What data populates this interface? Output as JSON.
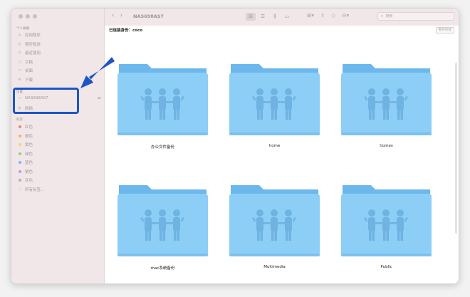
{
  "window": {
    "title": "NAS698AS7"
  },
  "sidebar": {
    "favorites_label": "个人收藏",
    "favorites": [
      {
        "label": "应用程序",
        "icon": "apps-icon"
      },
      {
        "label": "隔空投送",
        "icon": "airdrop-icon"
      },
      {
        "label": "最近使用",
        "icon": "clock-icon"
      },
      {
        "label": "文稿",
        "icon": "doc-icon"
      },
      {
        "label": "桌面",
        "icon": "desktop-icon"
      },
      {
        "label": "下载",
        "icon": "download-icon"
      }
    ],
    "locations_label": "位置",
    "locations": [
      {
        "label": "NAS698AS7",
        "icon": "server-icon"
      },
      {
        "label": "网络",
        "icon": "network-icon"
      }
    ],
    "tags_label": "标签",
    "tags": [
      {
        "label": "红色",
        "color": "#f0827e"
      },
      {
        "label": "橙色",
        "color": "#f3b36a"
      },
      {
        "label": "黄色",
        "color": "#f1d66a"
      },
      {
        "label": "绿色",
        "color": "#8dd27f"
      },
      {
        "label": "蓝色",
        "color": "#7fb4f0"
      },
      {
        "label": "紫色",
        "color": "#c596e6"
      },
      {
        "label": "灰色",
        "color": "#b5b0b2"
      }
    ],
    "all_tags": "所有标签…"
  },
  "toolbar": {
    "back": "‹",
    "forward": "›",
    "search_placeholder": "搜索"
  },
  "pathbar": {
    "connected_as": "已连接身份：coco",
    "disconnect": "断开连接"
  },
  "folders": [
    {
      "name": "办公文件备份"
    },
    {
      "name": "home"
    },
    {
      "name": "homes"
    },
    {
      "name": "mac系统备份"
    },
    {
      "name": "Multimedia"
    },
    {
      "name": "Public"
    }
  ],
  "colors": {
    "folder_body": "#8ccef5",
    "folder_back": "#6cb7ec",
    "highlight": "#1c55c8"
  }
}
